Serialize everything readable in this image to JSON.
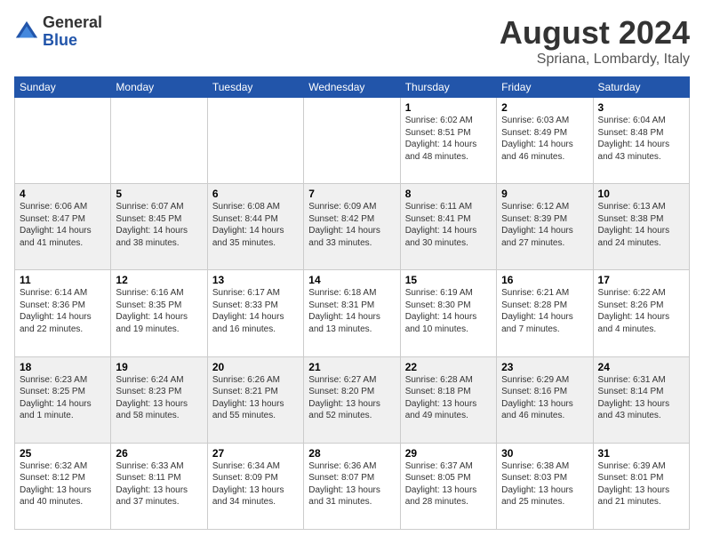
{
  "logo": {
    "general": "General",
    "blue": "Blue"
  },
  "header": {
    "month": "August 2024",
    "location": "Spriana, Lombardy, Italy"
  },
  "weekdays": [
    "Sunday",
    "Monday",
    "Tuesday",
    "Wednesday",
    "Thursday",
    "Friday",
    "Saturday"
  ],
  "weeks": [
    [
      {
        "day": "",
        "info": ""
      },
      {
        "day": "",
        "info": ""
      },
      {
        "day": "",
        "info": ""
      },
      {
        "day": "",
        "info": ""
      },
      {
        "day": "1",
        "info": "Sunrise: 6:02 AM\nSunset: 8:51 PM\nDaylight: 14 hours and 48 minutes."
      },
      {
        "day": "2",
        "info": "Sunrise: 6:03 AM\nSunset: 8:49 PM\nDaylight: 14 hours and 46 minutes."
      },
      {
        "day": "3",
        "info": "Sunrise: 6:04 AM\nSunset: 8:48 PM\nDaylight: 14 hours and 43 minutes."
      }
    ],
    [
      {
        "day": "4",
        "info": "Sunrise: 6:06 AM\nSunset: 8:47 PM\nDaylight: 14 hours and 41 minutes."
      },
      {
        "day": "5",
        "info": "Sunrise: 6:07 AM\nSunset: 8:45 PM\nDaylight: 14 hours and 38 minutes."
      },
      {
        "day": "6",
        "info": "Sunrise: 6:08 AM\nSunset: 8:44 PM\nDaylight: 14 hours and 35 minutes."
      },
      {
        "day": "7",
        "info": "Sunrise: 6:09 AM\nSunset: 8:42 PM\nDaylight: 14 hours and 33 minutes."
      },
      {
        "day": "8",
        "info": "Sunrise: 6:11 AM\nSunset: 8:41 PM\nDaylight: 14 hours and 30 minutes."
      },
      {
        "day": "9",
        "info": "Sunrise: 6:12 AM\nSunset: 8:39 PM\nDaylight: 14 hours and 27 minutes."
      },
      {
        "day": "10",
        "info": "Sunrise: 6:13 AM\nSunset: 8:38 PM\nDaylight: 14 hours and 24 minutes."
      }
    ],
    [
      {
        "day": "11",
        "info": "Sunrise: 6:14 AM\nSunset: 8:36 PM\nDaylight: 14 hours and 22 minutes."
      },
      {
        "day": "12",
        "info": "Sunrise: 6:16 AM\nSunset: 8:35 PM\nDaylight: 14 hours and 19 minutes."
      },
      {
        "day": "13",
        "info": "Sunrise: 6:17 AM\nSunset: 8:33 PM\nDaylight: 14 hours and 16 minutes."
      },
      {
        "day": "14",
        "info": "Sunrise: 6:18 AM\nSunset: 8:31 PM\nDaylight: 14 hours and 13 minutes."
      },
      {
        "day": "15",
        "info": "Sunrise: 6:19 AM\nSunset: 8:30 PM\nDaylight: 14 hours and 10 minutes."
      },
      {
        "day": "16",
        "info": "Sunrise: 6:21 AM\nSunset: 8:28 PM\nDaylight: 14 hours and 7 minutes."
      },
      {
        "day": "17",
        "info": "Sunrise: 6:22 AM\nSunset: 8:26 PM\nDaylight: 14 hours and 4 minutes."
      }
    ],
    [
      {
        "day": "18",
        "info": "Sunrise: 6:23 AM\nSunset: 8:25 PM\nDaylight: 14 hours and 1 minute."
      },
      {
        "day": "19",
        "info": "Sunrise: 6:24 AM\nSunset: 8:23 PM\nDaylight: 13 hours and 58 minutes."
      },
      {
        "day": "20",
        "info": "Sunrise: 6:26 AM\nSunset: 8:21 PM\nDaylight: 13 hours and 55 minutes."
      },
      {
        "day": "21",
        "info": "Sunrise: 6:27 AM\nSunset: 8:20 PM\nDaylight: 13 hours and 52 minutes."
      },
      {
        "day": "22",
        "info": "Sunrise: 6:28 AM\nSunset: 8:18 PM\nDaylight: 13 hours and 49 minutes."
      },
      {
        "day": "23",
        "info": "Sunrise: 6:29 AM\nSunset: 8:16 PM\nDaylight: 13 hours and 46 minutes."
      },
      {
        "day": "24",
        "info": "Sunrise: 6:31 AM\nSunset: 8:14 PM\nDaylight: 13 hours and 43 minutes."
      }
    ],
    [
      {
        "day": "25",
        "info": "Sunrise: 6:32 AM\nSunset: 8:12 PM\nDaylight: 13 hours and 40 minutes."
      },
      {
        "day": "26",
        "info": "Sunrise: 6:33 AM\nSunset: 8:11 PM\nDaylight: 13 hours and 37 minutes."
      },
      {
        "day": "27",
        "info": "Sunrise: 6:34 AM\nSunset: 8:09 PM\nDaylight: 13 hours and 34 minutes."
      },
      {
        "day": "28",
        "info": "Sunrise: 6:36 AM\nSunset: 8:07 PM\nDaylight: 13 hours and 31 minutes."
      },
      {
        "day": "29",
        "info": "Sunrise: 6:37 AM\nSunset: 8:05 PM\nDaylight: 13 hours and 28 minutes."
      },
      {
        "day": "30",
        "info": "Sunrise: 6:38 AM\nSunset: 8:03 PM\nDaylight: 13 hours and 25 minutes."
      },
      {
        "day": "31",
        "info": "Sunrise: 6:39 AM\nSunset: 8:01 PM\nDaylight: 13 hours and 21 minutes."
      }
    ]
  ]
}
